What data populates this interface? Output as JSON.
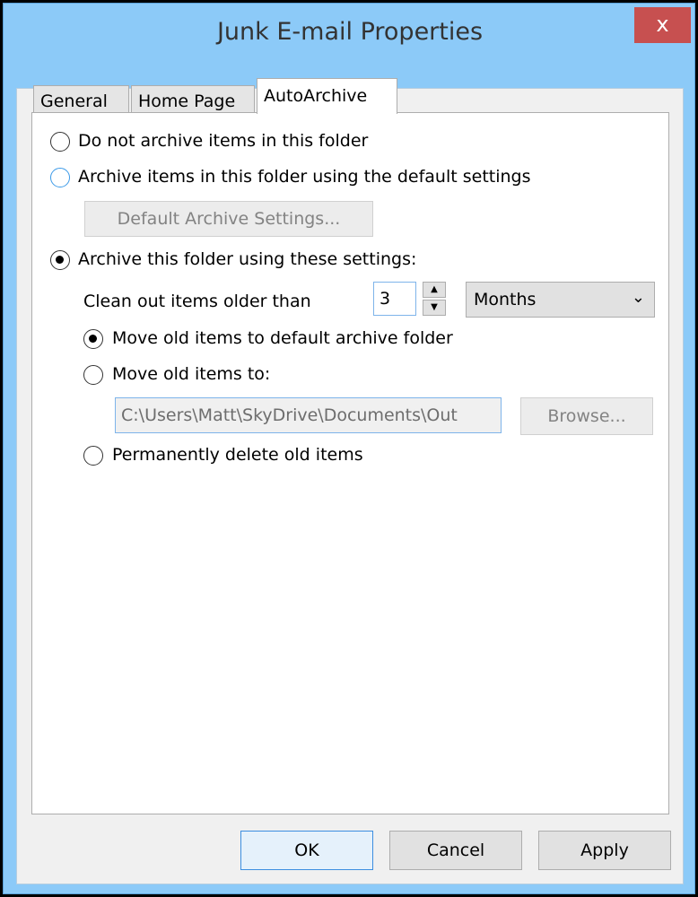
{
  "window": {
    "title": "Junk E-mail Properties",
    "close": "x"
  },
  "tabs": [
    {
      "label": "General"
    },
    {
      "label": "Home Page"
    },
    {
      "label": "AutoArchive",
      "active": true
    }
  ],
  "options": {
    "no_archive": "Do not archive items in this folder",
    "default_archive": "Archive items in this folder using the default settings",
    "default_settings_button": "Default Archive Settings...",
    "custom_archive": "Archive this folder using these settings:",
    "clean_label": "Clean out items older than",
    "clean_value": "3",
    "clean_unit": "Months",
    "move_default": "Move old items to default archive folder",
    "move_to": "Move old items to:",
    "path_value": "C:\\Users\\Matt\\SkyDrive\\Documents\\Out",
    "browse": "Browse...",
    "delete": "Permanently delete old items"
  },
  "buttons": {
    "ok": "OK",
    "cancel": "Cancel",
    "apply": "Apply"
  }
}
